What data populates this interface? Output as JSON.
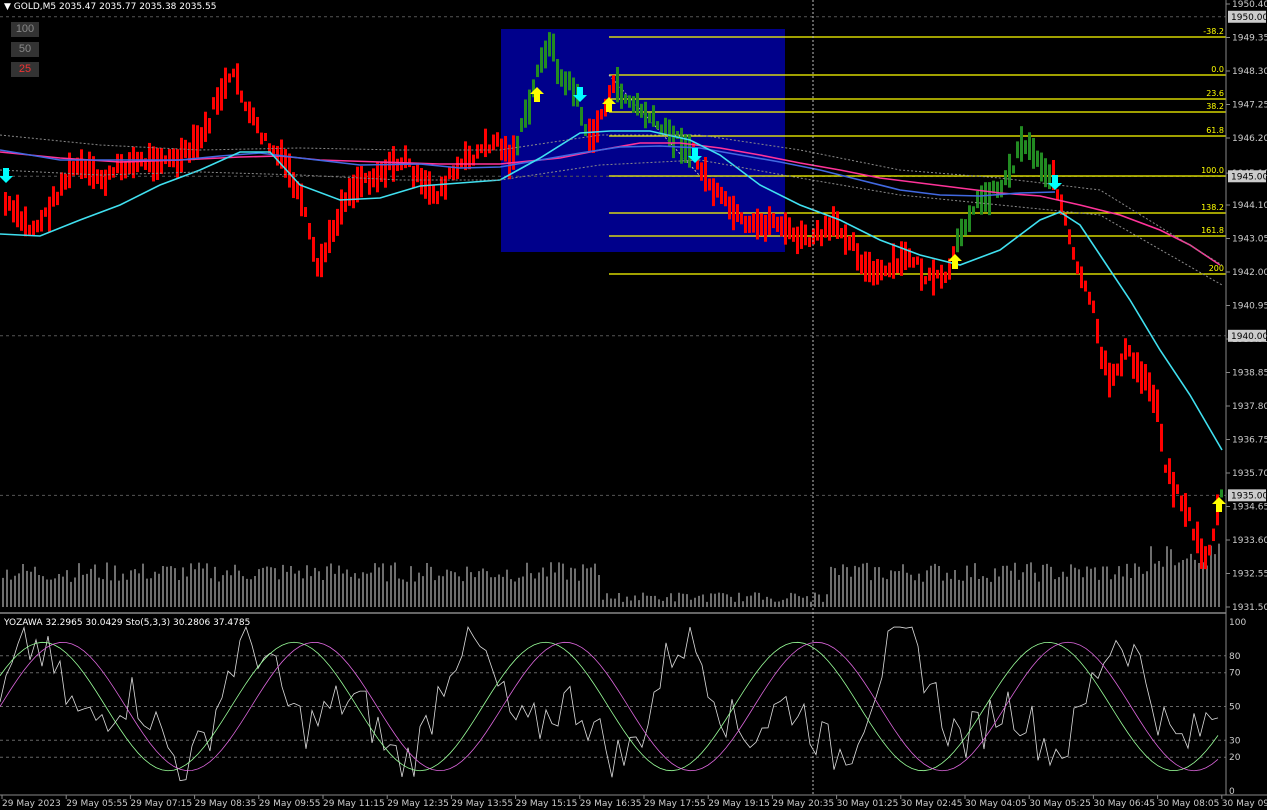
{
  "header": {
    "symbol": "GOLD,M5",
    "ohlc": "2035.47 2035.77 2035.38 2035.55"
  },
  "zoom_buttons": [
    {
      "label": "100"
    },
    {
      "label": "50"
    },
    {
      "label": "25"
    }
  ],
  "indicator": {
    "title": "YOZAWA 32.2965 30.0429  Sto(5,3,3) 30.2806 37.4785",
    "levels": [
      "100",
      "80",
      "70",
      "50",
      "30",
      "20",
      "0"
    ]
  },
  "price_axis": {
    "ticks": [
      "1950.40",
      "1949.35",
      "1948.30",
      "1947.25",
      "1946.20",
      "1945.10",
      "1944.10",
      "1943.05",
      "1942.00",
      "1940.95",
      "1939.90",
      "1938.85",
      "1937.80",
      "1936.75",
      "1935.70",
      "1934.65",
      "1933.60",
      "1932.55",
      "1931.50"
    ],
    "boxed": [
      "1950.00",
      "1945.00",
      "1940.00",
      "1935.00"
    ]
  },
  "fib_levels": [
    "-38.2",
    "0.0",
    "23.6",
    "38.2",
    "61.8",
    "100.0",
    "138.2",
    "161.8",
    "200"
  ],
  "time_axis": [
    "29 May 2023",
    "29 May 05:55",
    "29 May 07:15",
    "29 May 08:35",
    "29 May 09:55",
    "29 May 11:15",
    "29 May 12:35",
    "29 May 13:55",
    "29 May 15:15",
    "29 May 16:35",
    "29 May 17:55",
    "29 May 19:15",
    "29 May 20:35",
    "30 May 01:25",
    "30 May 02:45",
    "30 May 04:05",
    "30 May 05:25",
    "30 May 06:45",
    "30 May 08:05",
    "30 May 09:25"
  ],
  "colors": {
    "bull": "#228B22",
    "bear": "#FF0000",
    "fib": "#FFFF00",
    "box": "#00008B",
    "ma_fast": "#40E0F0",
    "ma_mid": "#4169E1",
    "ma_slow": "#FF3399",
    "arrow_up": "#FFFF00",
    "arrow_down": "#00FFFF"
  }
}
